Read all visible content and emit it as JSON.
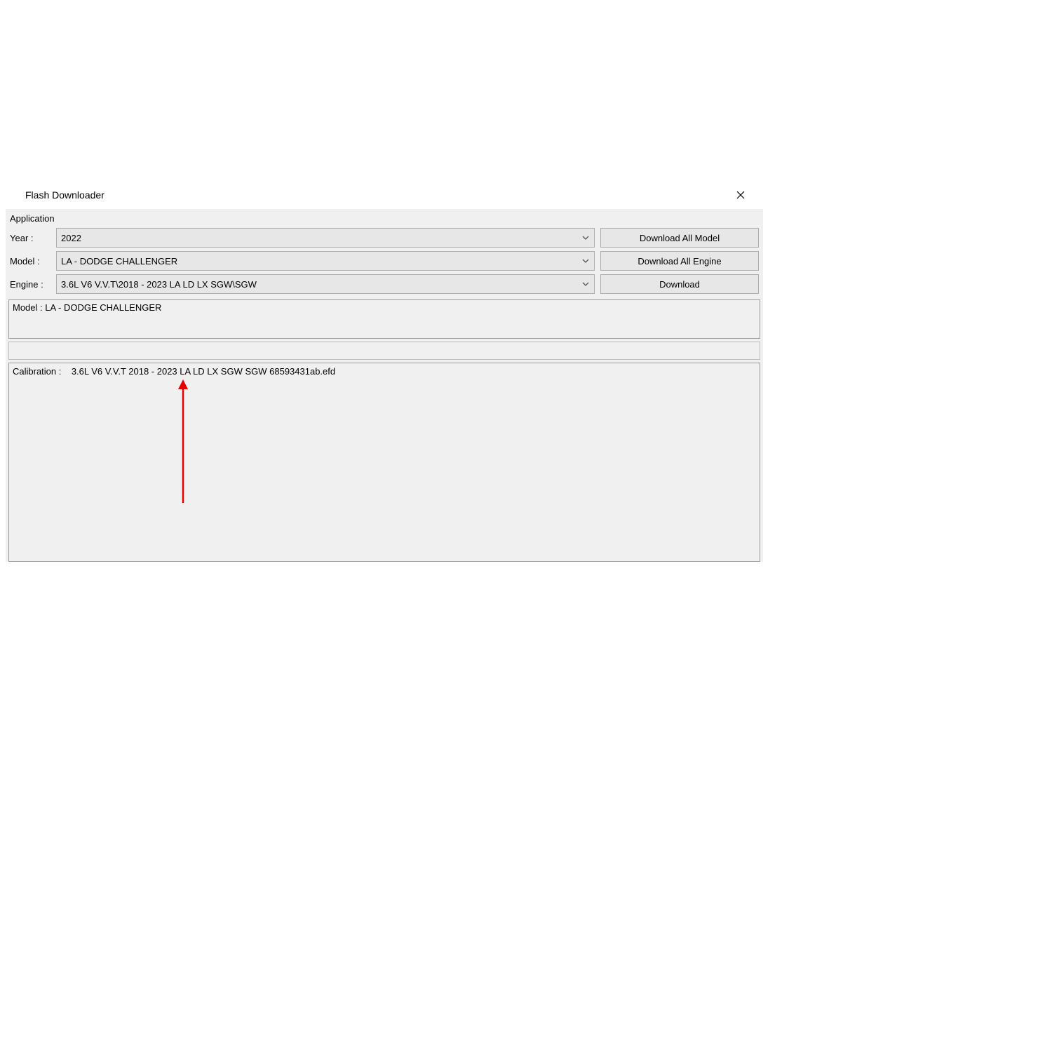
{
  "window": {
    "title": "Flash Downloader",
    "section_label": "Application"
  },
  "form": {
    "year_label": "Year :",
    "year_value": "2022",
    "model_label": "Model :",
    "model_value": "LA - DODGE CHALLENGER",
    "engine_label": "Engine :",
    "engine_value": "3.6L V6 V.V.T\\2018 - 2023 LA LD LX SGW\\SGW"
  },
  "buttons": {
    "download_all_model": "Download All Model",
    "download_all_engine": "Download All Engine",
    "download": "Download"
  },
  "panels": {
    "model_line": "Model : LA - DODGE CHALLENGER",
    "calibration_line": "Calibration :    3.6L V6 V.V.T 2018 - 2023 LA LD LX SGW SGW 68593431ab.efd"
  }
}
